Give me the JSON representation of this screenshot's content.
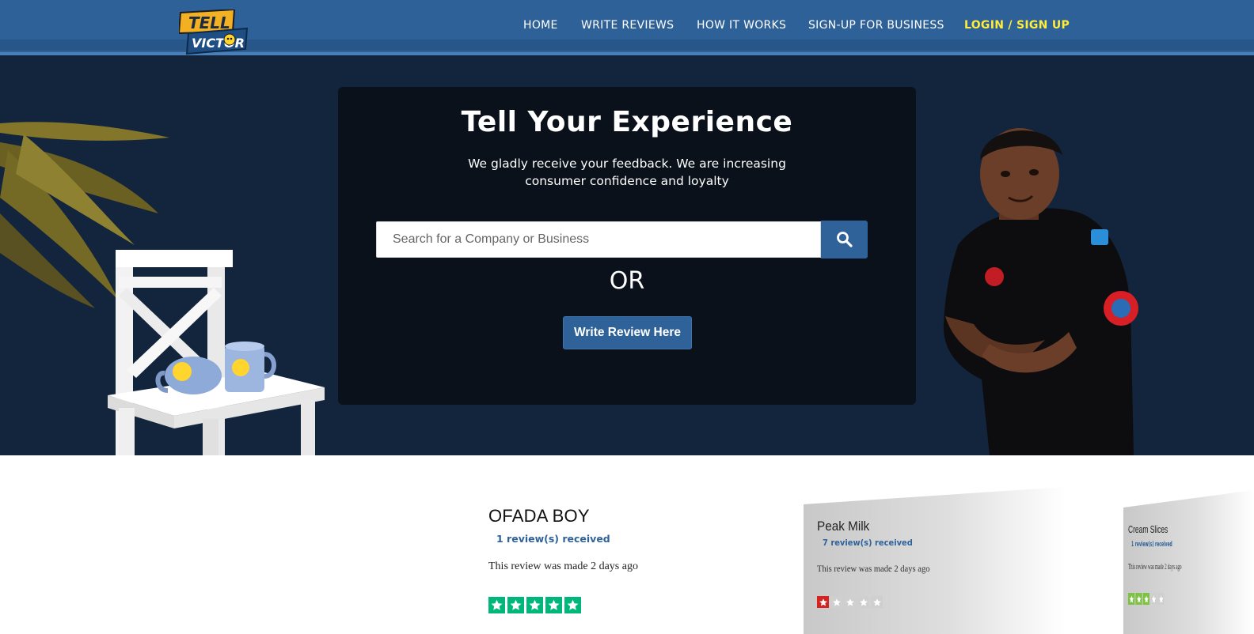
{
  "brand": {
    "logo_top": "TELL",
    "logo_bottom": "VICTOR",
    "primary_color": "#2f6199",
    "accent_color": "#ffed3a"
  },
  "nav": {
    "items": [
      {
        "label": "HOME"
      },
      {
        "label": "WRITE REVIEWS"
      },
      {
        "label": "HOW IT WORKS"
      },
      {
        "label": "SIGN-UP FOR BUSINESS"
      }
    ],
    "cta_label": "LOGIN / SIGN UP"
  },
  "hero": {
    "title": "Tell Your Experience",
    "subtitle": "We gladly receive your feedback. We are increasing consumer confidence and loyalty",
    "search": {
      "placeholder": "Search for a Company or Business",
      "value": "",
      "button_icon": "search-icon"
    },
    "or_text": "OR",
    "write_button": "Write Review Here"
  },
  "reviews": [
    {
      "name": "OFADA BOY",
      "count": "1 review(s) received",
      "date": "This review was made 2 days ago",
      "rating": 5,
      "star_color": "#00b67a"
    },
    {
      "name": "Peak Milk",
      "count": "7 review(s) received",
      "date": "This review was made 2 days ago",
      "rating": 1,
      "star_color": "#d6231f"
    },
    {
      "name": "Cream Slices",
      "count": "1 review(s) received",
      "date": "This review was made 2 days ago",
      "rating": 3,
      "star_color": "#7ec242"
    }
  ]
}
